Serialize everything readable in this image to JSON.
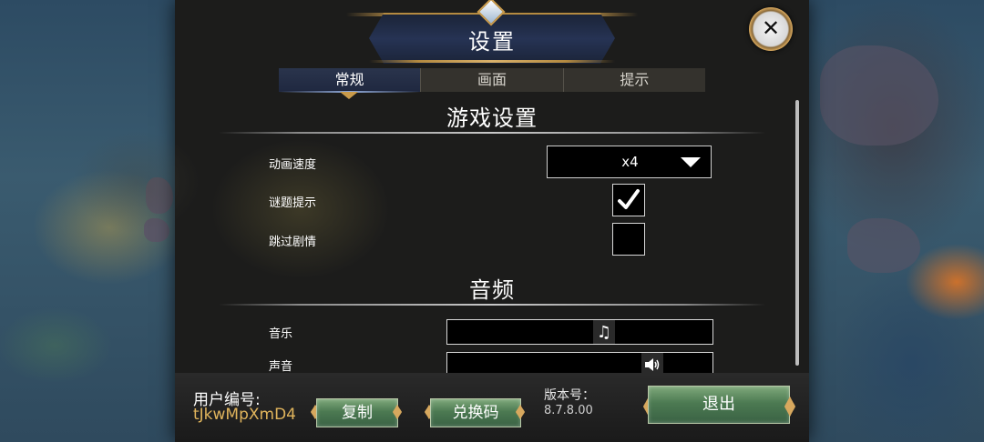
{
  "title": "设置",
  "tabs": [
    {
      "label": "常规",
      "active": true
    },
    {
      "label": "画面",
      "active": false
    },
    {
      "label": "提示",
      "active": false
    }
  ],
  "game_settings": {
    "heading": "游戏设置",
    "animation_speed": {
      "label": "动画速度",
      "value": "x4"
    },
    "puzzle_hints": {
      "label": "谜题提示",
      "checked": true
    },
    "skip_story": {
      "label": "跳过剧情",
      "checked": false
    }
  },
  "audio": {
    "heading": "音频",
    "music": {
      "label": "音乐",
      "level": 0.59,
      "icon": "music-note-icon"
    },
    "sound": {
      "label": "声音",
      "level": 0.77,
      "icon": "speaker-icon"
    }
  },
  "footer": {
    "user_label": "用户编号:",
    "user_id": "tJkwMpXmD4",
    "copy_label": "复制",
    "redeem_label": "兑换码",
    "version_label": "版本号：",
    "version_value": "8.7.8.00",
    "exit_label": "退出"
  },
  "colors": {
    "accent_gold": "#c99a4a",
    "user_id_color": "#e0b45c",
    "button_green": "#4c7a52"
  }
}
